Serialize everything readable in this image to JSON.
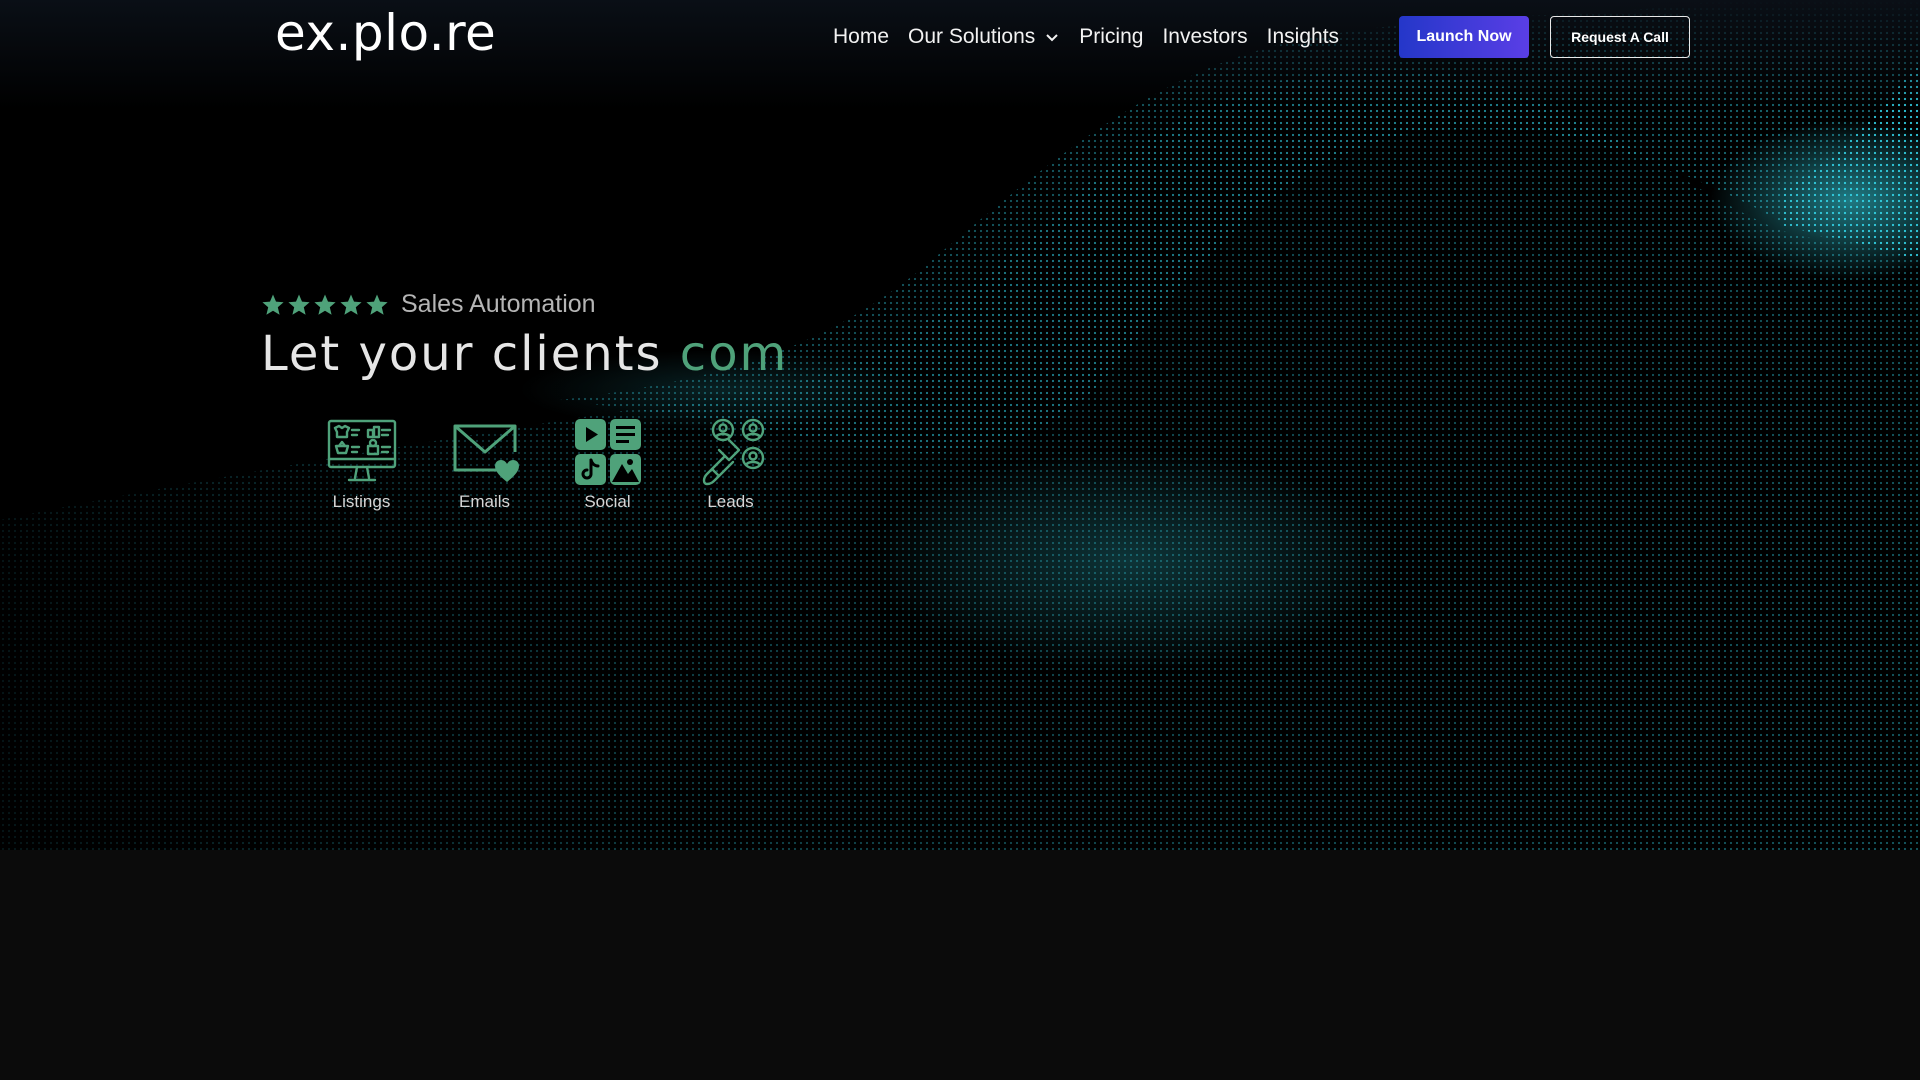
{
  "brand": {
    "logo": "ex.plo.re"
  },
  "nav": {
    "items": [
      {
        "label": "Home"
      },
      {
        "label": "Our Solutions",
        "has_dropdown": true
      },
      {
        "label": "Pricing"
      },
      {
        "label": "Investors"
      },
      {
        "label": "Insights"
      }
    ],
    "launch_label": "Launch Now",
    "call_label": "Request A Call"
  },
  "hero": {
    "rating_stars": 5,
    "rating_label": "Sales Automation",
    "headline_static": "Let your clients ",
    "headline_accent": "com",
    "features": [
      {
        "label": "Listings",
        "icon": "listings-monitor-icon"
      },
      {
        "label": "Emails",
        "icon": "email-heart-icon"
      },
      {
        "label": "Social",
        "icon": "social-media-grid-icon"
      },
      {
        "label": "Leads",
        "icon": "lead-magnet-icon"
      }
    ]
  },
  "colors": {
    "accent_green": "#4fa27a",
    "wave_cyan": "#2fd5e6",
    "launch_gradient_start": "#2437c9",
    "launch_gradient_end": "#5a3ee6",
    "background": "#000000"
  }
}
